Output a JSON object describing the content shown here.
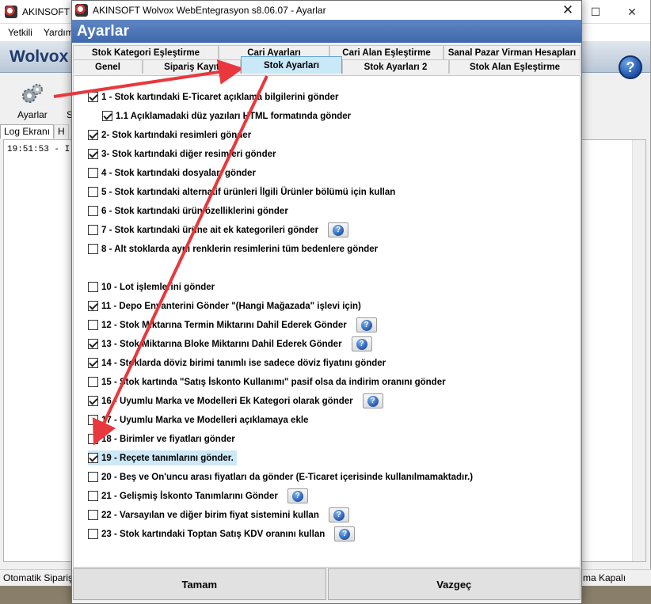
{
  "main": {
    "title": "AKINSOFT W",
    "menu": [
      "Yetkili",
      "Yardım"
    ],
    "header_title": "Wolvox",
    "toolbar": {
      "ayarlar_label": "Ayarlar",
      "second_label": "S"
    },
    "tabs": [
      "Log Ekranı",
      "H"
    ],
    "log_line": "19:51:53 - I",
    "status_left": "Otomatik Sipariş",
    "status_right": "ma Kapalı",
    "help_label": "?"
  },
  "dialog": {
    "title": "AKINSOFT Wolvox WebEntegrasyon s8.06.07 - Ayarlar",
    "header": "Ayarlar",
    "tabs_row1": [
      "Stok Kategori Eşleştirme",
      "Cari Ayarları",
      "Cari Alan Eşleştirme",
      "Sanal Pazar Virman Hesapları"
    ],
    "tabs_row2": [
      "Genel",
      "Sipariş Kayıt",
      "Stok Ayarları",
      "Stok Ayarları 2",
      "Stok Alan Eşleştirme"
    ],
    "active_tab": "Stok Ayarları",
    "options": [
      {
        "label": "1 - Stok kartındaki E-Ticaret açıklama bilgilerini gönder",
        "checked": true,
        "info": false
      },
      {
        "label": "1.1 Açıklamadaki düz yazıları HTML formatında gönder",
        "checked": true,
        "info": false
      },
      {
        "label": "2- Stok kartındaki resimleri gönder",
        "checked": true,
        "info": false
      },
      {
        "label": "3- Stok kartındaki diğer resimleri gönder",
        "checked": true,
        "info": false
      },
      {
        "label": "4 - Stok kartındaki dosyaları gönder",
        "checked": false,
        "info": false
      },
      {
        "label": "5 - Stok kartındaki alternatif ürünleri İlgili Ürünler bölümü için kullan",
        "checked": false,
        "info": false
      },
      {
        "label": "6 - Stok kartındaki ürün özelliklerini gönder",
        "checked": false,
        "info": false
      },
      {
        "label": "7 - Stok kartındaki ürüne ait ek kategorileri gönder",
        "checked": false,
        "info": true
      },
      {
        "label": "8 - Alt stoklarda aynı renklerin resimlerini tüm bedenlere gönder",
        "checked": false,
        "info": false
      },
      {
        "label": "",
        "checked": false,
        "info": false
      },
      {
        "label": "10 - Lot işlemlerini gönder",
        "checked": false,
        "info": false
      },
      {
        "label": "11 - Depo Envanterini Gönder \"(Hangi Mağazada\" işlevi için)",
        "checked": true,
        "info": false
      },
      {
        "label": "12 - Stok Miktarına Termin Miktarını Dahil Ederek Gönder",
        "checked": false,
        "info": true
      },
      {
        "label": "13 - Stok Miktarına Bloke Miktarını Dahil Ederek Gönder",
        "checked": true,
        "info": true
      },
      {
        "label": "14 - Stoklarda döviz birimi tanımlı ise sadece döviz fiyatını gönder",
        "checked": true,
        "info": false
      },
      {
        "label": "15 - Stok kartında \"Satış İskonto Kullanımı\" pasif olsa da indirim oranını gönder",
        "checked": false,
        "info": false
      },
      {
        "label": "16 - Uyumlu Marka ve Modelleri Ek Kategori olarak gönder",
        "checked": true,
        "info": true
      },
      {
        "label": "17 - Uyumlu Marka ve Modelleri açıklamaya ekle",
        "checked": false,
        "info": false
      },
      {
        "label": "18 - Birimler ve fiyatları gönder",
        "checked": false,
        "info": false
      },
      {
        "label": "19 - Reçete tanımlarını gönder.",
        "checked": true,
        "info": false,
        "highlight": true
      },
      {
        "label": "20 - Beş ve On'uncu arası fiyatları da gönder (E-Ticaret içerisinde kullanılmamaktadır.)",
        "checked": false,
        "info": false
      },
      {
        "label": "21 - Gelişmiş İskonto Tanımlarını Gönder",
        "checked": false,
        "info": true
      },
      {
        "label": "22 - Varsayılan ve diğer birim fiyat sistemini kullan",
        "checked": false,
        "info": true
      },
      {
        "label": "23 - Stok kartındaki Toptan Satış KDV oranını kullan",
        "checked": false,
        "info": true
      }
    ],
    "buttons": {
      "ok": "Tamam",
      "cancel": "Vazgeç"
    },
    "info_glyph": "?"
  },
  "colors": {
    "header_blue": "#3f69ad",
    "active_tab": "#c9e8f8",
    "highlight": "#cde8f7",
    "arrow_red": "#e8383d"
  },
  "icons": [
    "gears-icon",
    "info-icon",
    "help-icon",
    "close-icon",
    "app-logo-icon"
  ]
}
